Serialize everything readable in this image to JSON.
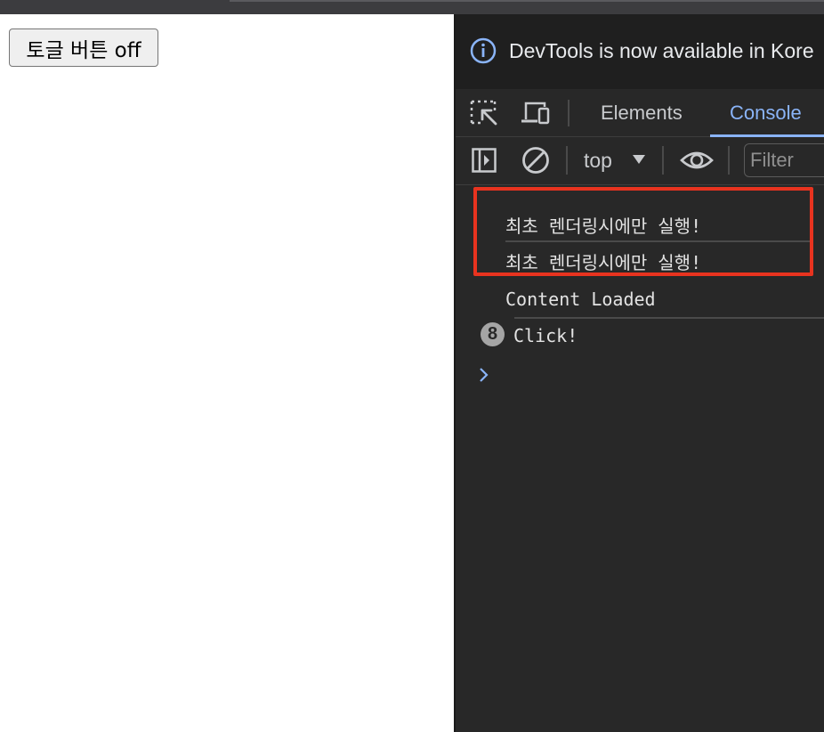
{
  "page": {
    "toggle_button_label": "토글 버튼 off"
  },
  "devtools": {
    "info_bar": {
      "icon": "info-icon",
      "text": "DevTools is now available in Kore"
    },
    "tabs": [
      {
        "label": "Elements",
        "active": false
      },
      {
        "label": "Console",
        "active": true
      }
    ],
    "toolbar": {
      "context": "top",
      "filter_placeholder": "Filter"
    },
    "console": {
      "messages": [
        {
          "text": "최초 렌더링시에만 실행!",
          "count": null
        },
        {
          "text": "최초 렌더링시에만 실행!",
          "count": null
        },
        {
          "text": "Content Loaded",
          "count": null
        },
        {
          "text": "Click!",
          "count": "8"
        }
      ],
      "highlight_color": "#e8331f"
    },
    "colors": {
      "accent": "#8ab4f8",
      "background": "#282828"
    }
  }
}
